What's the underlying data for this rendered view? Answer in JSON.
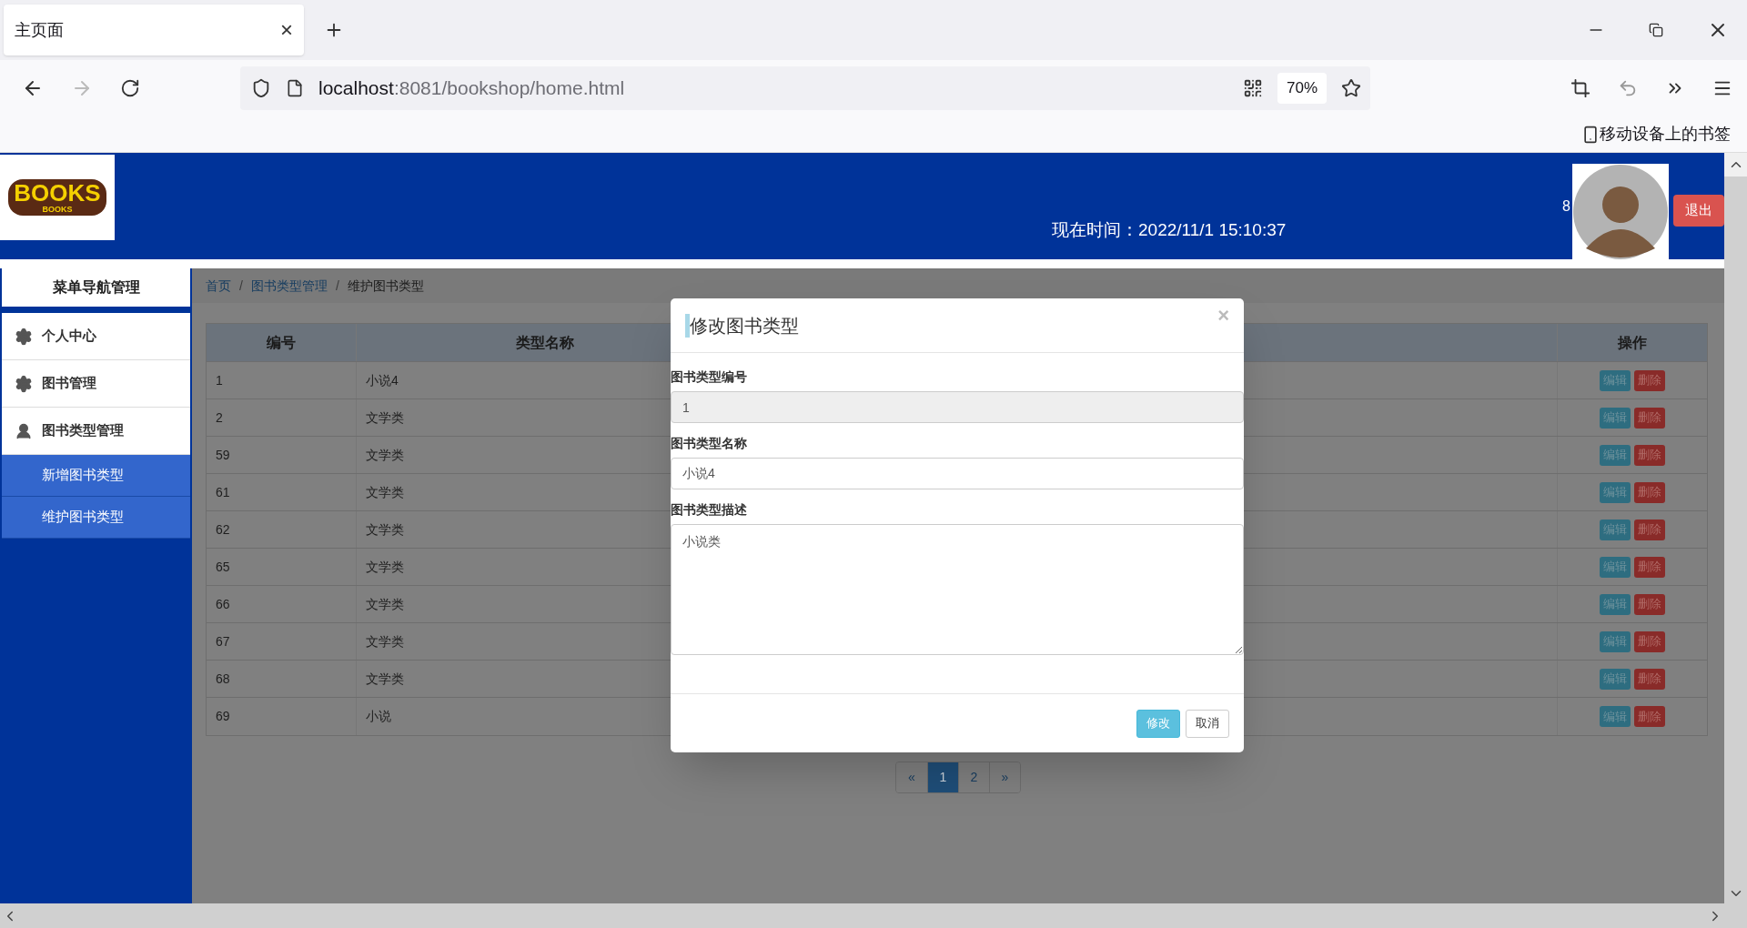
{
  "browser": {
    "tab": {
      "title": "主页面",
      "close": "×"
    },
    "url": {
      "host": "localhost",
      "path": ":8081/bookshop/home.html"
    },
    "zoom": "70%",
    "bookmark": "移动设备上的书签"
  },
  "header": {
    "logo": {
      "main": "BOOKS",
      "sub": "BOOKS"
    },
    "time": "现在时间：2022/11/1 15:10:37",
    "user_count": "8",
    "logout": "退出"
  },
  "sidebar": {
    "title": "菜单导航管理",
    "items": [
      {
        "label": "个人中心"
      },
      {
        "label": "图书管理"
      },
      {
        "label": "图书类型管理",
        "children": [
          {
            "label": "新增图书类型"
          },
          {
            "label": "维护图书类型"
          }
        ]
      }
    ]
  },
  "breadcrumb": [
    {
      "label": "首页",
      "selected": false
    },
    {
      "separator": "/",
      "label": "图书类型管理",
      "selected": false
    },
    {
      "separator": "/",
      "label": "维护图书类型",
      "selected": true
    }
  ],
  "table": {
    "columns": [
      "编号",
      "类型名称",
      "操作"
    ],
    "rows": [
      {
        "cells": [
          "1",
          "小说4"
        ],
        "actions": [
          "编辑",
          "删除"
        ]
      },
      {
        "cells": [
          "2",
          "文学类"
        ],
        "actions": [
          "编辑",
          "删除"
        ]
      },
      {
        "cells": [
          "59",
          "文学类"
        ],
        "actions": [
          "编辑",
          "删除"
        ]
      },
      {
        "cells": [
          "61",
          "文学类"
        ],
        "actions": [
          "编辑",
          "删除"
        ]
      },
      {
        "cells": [
          "62",
          "文学类"
        ],
        "actions": [
          "编辑",
          "删除"
        ]
      },
      {
        "cells": [
          "65",
          "文学类"
        ],
        "actions": [
          "编辑",
          "删除"
        ]
      },
      {
        "cells": [
          "66",
          "文学类"
        ],
        "actions": [
          "编辑",
          "删除"
        ]
      },
      {
        "cells": [
          "67",
          "文学类"
        ],
        "actions": [
          "编辑",
          "删除"
        ]
      },
      {
        "cells": [
          "68",
          "文学类"
        ],
        "actions": [
          "编辑",
          "删除"
        ]
      },
      {
        "cells": [
          "69",
          "小说"
        ],
        "actions": [
          "编辑",
          "删除"
        ]
      }
    ]
  },
  "pagination": [
    {
      "label": "«",
      "selected": false
    },
    {
      "label": "1",
      "selected": true
    },
    {
      "label": "2",
      "selected": false
    },
    {
      "label": "»",
      "selected": false
    }
  ],
  "modal": {
    "title": "修改图书类型",
    "close": "×",
    "fields": [
      {
        "label": "图书类型编号",
        "kind": "input",
        "value": "1",
        "disabled": true
      },
      {
        "label": "图书类型名称",
        "kind": "input",
        "value": "小说4",
        "disabled": false
      },
      {
        "label": "图书类型描述",
        "kind": "textarea",
        "value": "小说类",
        "disabled": false
      }
    ],
    "buttons": [
      {
        "label": "修改",
        "kind": "primary"
      },
      {
        "label": "取消",
        "kind": "default"
      }
    ]
  }
}
